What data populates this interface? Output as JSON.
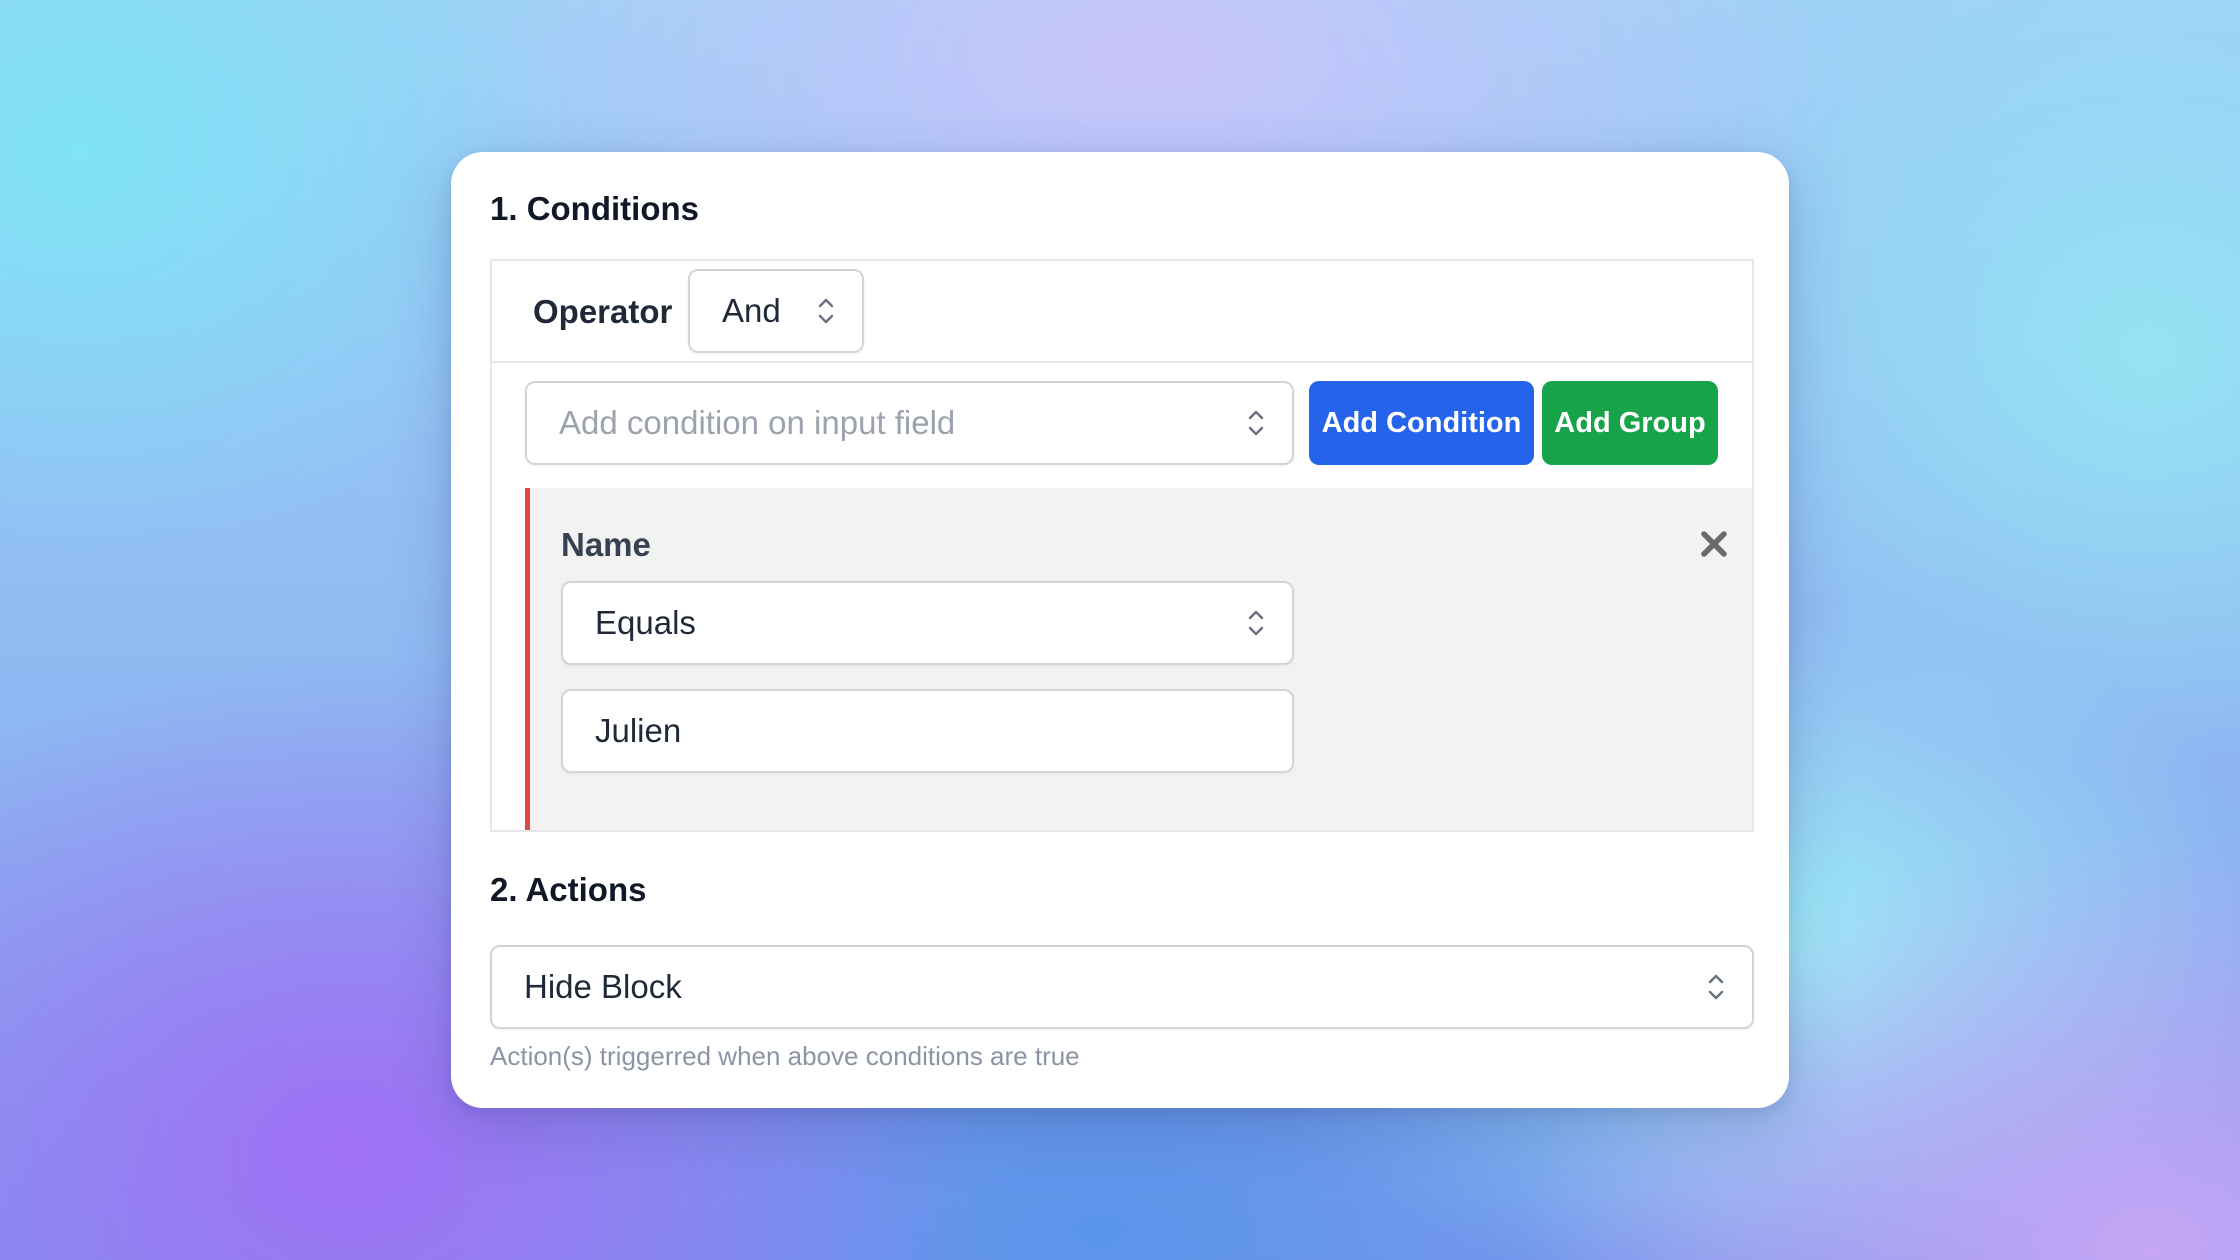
{
  "conditions": {
    "title": "1. Conditions",
    "operator_label": "Operator",
    "operator_value": "And",
    "field_placeholder": "Add condition on input field",
    "add_condition_label": "Add Condition",
    "add_group_label": "Add Group",
    "group": {
      "field_name": "Name",
      "comparator": "Equals",
      "value": "Julien",
      "close_icon": "close-icon"
    }
  },
  "actions": {
    "title": "2. Actions",
    "selected_action": "Hide Block",
    "helper_text": "Action(s) triggerred when above conditions are true"
  },
  "colors": {
    "primary_button": "#2563eb",
    "success_button": "#16a34a",
    "group_accent": "#e04848",
    "group_background": "#f2f2f2"
  }
}
